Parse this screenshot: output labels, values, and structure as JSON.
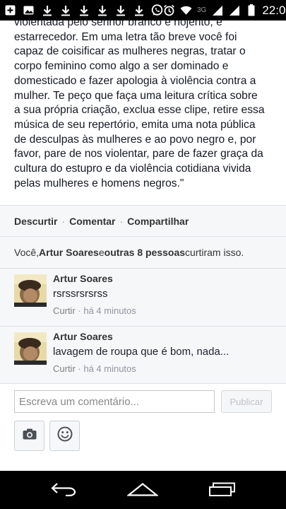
{
  "status_bar": {
    "time": "22:04",
    "network": "3G",
    "icons_left": [
      "add-box-icon",
      "image-icon",
      "download-icon",
      "download-icon",
      "download-icon",
      "download-icon",
      "download-icon",
      "download-icon",
      "whatsapp-icon"
    ],
    "icons_right": [
      "alarm-icon",
      "wifi-icon",
      "signal-icon",
      "signal-icon",
      "battery-icon"
    ]
  },
  "post": {
    "text": "violentada pelo senhor branco é nojento, é\nestarrecedor. Em uma letra tão breve você foi\ncapaz de coisificar as mulheres negras, tratar o\ncorpo feminino como algo a ser dominado e\ndomesticado e fazer apologia à violência contra a\nmulher. Te peço que faça uma leitura crítica sobre\na sua própria criação, exclua esse clipe, retire essa\nmúsica de seu repertório, emita uma nota pública\nde desculpas às mulheres e ao povo negro e, por\nfavor, pare de nos violentar, pare de fazer graça da\ncultura do estupro e da violência cotidiana vivida\npelas mulheres e homens negros.\""
  },
  "actions": {
    "dislike": "Descurtir",
    "comment": "Comentar",
    "share": "Compartilhar",
    "separator": "·"
  },
  "likes": {
    "prefix": "Você, ",
    "name": "Artur Soares",
    "middle": " e ",
    "others": "outras 8 pessoas",
    "suffix": " curtiram isso."
  },
  "comments": [
    {
      "author": "Artur Soares",
      "text": "rsrssrsrsrss",
      "like": "Curtir",
      "separator": " · ",
      "time": "há 4 minutos"
    },
    {
      "author": "Artur Soares",
      "text": "lavagem de roupa que é bom, nada...",
      "like": "Curtir",
      "separator": " · ",
      "time": "há 4 minutos"
    }
  ],
  "composer": {
    "placeholder": "Escreva um comentário...",
    "publish": "Publicar",
    "camera_icon": "camera-icon",
    "sticker_icon": "smiley-icon"
  },
  "nav": [
    "back-icon",
    "home-icon",
    "recents-icon"
  ],
  "colors": {
    "status_bar": "#000000",
    "background": "#e9eaed",
    "text": "#141823",
    "meta": "#90949c"
  }
}
